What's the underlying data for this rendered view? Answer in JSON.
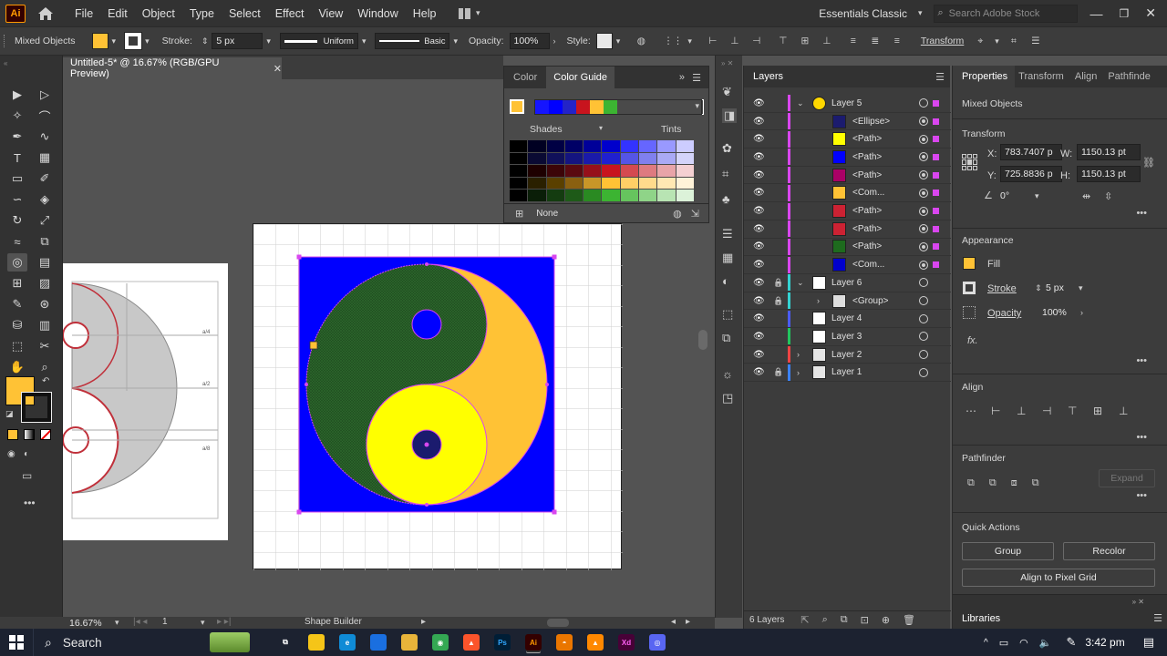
{
  "menu": {
    "items": [
      "File",
      "Edit",
      "Object",
      "Type",
      "Select",
      "Effect",
      "View",
      "Window",
      "Help"
    ],
    "workspace": "Essentials Classic",
    "search_placeholder": "Search Adobe Stock"
  },
  "control": {
    "selection_label": "Mixed Objects",
    "stroke_label": "Stroke:",
    "stroke_value": "5 px",
    "profile": "Uniform",
    "brush": "Basic",
    "opacity_label": "Opacity:",
    "opacity_value": "100%",
    "style_label": "Style:",
    "transform_label": "Transform",
    "fill_color": "#ffc235"
  },
  "document": {
    "tab_title": "Untitled-5* @ 16.67% (RGB/GPU Preview)"
  },
  "color_panel": {
    "tab_color": "Color",
    "tab_guide": "Color Guide",
    "shades": "Shades",
    "tints": "Tints",
    "none_label": "None",
    "harmony": [
      "#1515ff",
      "#0000ff",
      "#2323c8",
      "#c8141e",
      "#ffc235",
      "#3cb432"
    ],
    "rows": [
      [
        "#000000",
        "#000022",
        "#000044",
        "#000066",
        "#000099",
        "#0000cc",
        "#3333ff",
        "#6666ff",
        "#9999ff",
        "#ccccff"
      ],
      [
        "#000000",
        "#0a0a33",
        "#10105a",
        "#141480",
        "#1a1aaa",
        "#2020d0",
        "#5555e6",
        "#8080ee",
        "#aaaaf5",
        "#d4d4fa"
      ],
      [
        "#000000",
        "#1e0000",
        "#3c0508",
        "#5a0a10",
        "#96101a",
        "#c8141e",
        "#d44a50",
        "#de7a80",
        "#e8a4a8",
        "#f4d0d2"
      ],
      [
        "#000000",
        "#2a2000",
        "#5a4000",
        "#8a6010",
        "#c89628",
        "#ffc235",
        "#ffcf66",
        "#ffdb8c",
        "#ffe8b3",
        "#fff3d9"
      ],
      [
        "#000000",
        "#0a1e08",
        "#143c10",
        "#1e5a18",
        "#2a8a22",
        "#3cb432",
        "#66c45e",
        "#8fd488",
        "#b8e4b3",
        "#dcf2d9"
      ]
    ]
  },
  "layers": {
    "title": "Layers",
    "footer_count": "6 Layers",
    "rows": [
      {
        "name": "Layer 5",
        "indent": 0,
        "thumb": "#ffd700",
        "color": "#d946ef",
        "expanded": true
      },
      {
        "name": "<Ellipse>",
        "indent": 1,
        "thumb": "#1b1b6e",
        "color": "#d946ef"
      },
      {
        "name": "<Path>",
        "indent": 1,
        "thumb": "#ffff00",
        "color": "#d946ef"
      },
      {
        "name": "<Path>",
        "indent": 1,
        "thumb": "#0000ff",
        "color": "#d946ef"
      },
      {
        "name": "<Path>",
        "indent": 1,
        "thumb": "#aa0066",
        "color": "#d946ef"
      },
      {
        "name": "<Com...",
        "indent": 1,
        "thumb": "#ffc235",
        "color": "#d946ef"
      },
      {
        "name": "<Path>",
        "indent": 1,
        "thumb": "#cc2233",
        "color": "#d946ef"
      },
      {
        "name": "<Path>",
        "indent": 1,
        "thumb": "#cc2233",
        "color": "#d946ef"
      },
      {
        "name": "<Path>",
        "indent": 1,
        "thumb": "#1e6b1e",
        "color": "#d946ef"
      },
      {
        "name": "<Com...",
        "indent": 1,
        "thumb": "#0000cc",
        "color": "#d946ef"
      },
      {
        "name": "Layer 6",
        "indent": 0,
        "thumb": "#ffffff",
        "color": "#34d3d3",
        "expanded": true,
        "locked": true
      },
      {
        "name": "<Group>",
        "indent": 1,
        "thumb": "#dddddd",
        "color": "#34d3d3",
        "locked": true
      },
      {
        "name": "Layer 4",
        "indent": 0,
        "thumb": "#ffffff",
        "color": "#4b5cf5"
      },
      {
        "name": "Layer 3",
        "indent": 0,
        "thumb": "#ffffff",
        "color": "#22c55e"
      },
      {
        "name": "Layer 2",
        "indent": 0,
        "thumb": "#e5e5e5",
        "color": "#ef4444"
      },
      {
        "name": "Layer 1",
        "indent": 0,
        "thumb": "#e5e5e5",
        "color": "#3b82f6",
        "locked": true
      }
    ]
  },
  "properties": {
    "tabs": [
      "Properties",
      "Transform",
      "Align",
      "Pathfinde"
    ],
    "selection": "Mixed Objects",
    "transform_title": "Transform",
    "x_label": "X:",
    "x_value": "783.7407 p",
    "y_label": "Y:",
    "y_value": "725.8836 p",
    "w_label": "W:",
    "w_value": "1150.13 pt",
    "h_label": "H:",
    "h_value": "1150.13 pt",
    "angle_value": "0°",
    "appearance_title": "Appearance",
    "fill_label": "Fill",
    "stroke_label": "Stroke",
    "stroke_value": "5 px",
    "opacity_label": "Opacity",
    "opacity_value": "100%",
    "fx_label": "fx.",
    "align_title": "Align",
    "pathfinder_title": "Pathfinder",
    "expand_label": "Expand",
    "quick_title": "Quick Actions",
    "group_label": "Group",
    "recolor_label": "Recolor",
    "pixel_grid_label": "Align to Pixel Grid",
    "libraries_label": "Libraries"
  },
  "status": {
    "zoom": "16.67%",
    "artboard": "1",
    "tool": "Shape Builder"
  },
  "taskbar": {
    "search": "Search",
    "time": "3:42 pm"
  }
}
